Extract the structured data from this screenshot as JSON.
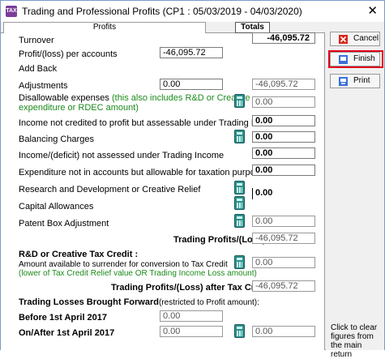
{
  "window": {
    "app_icon_text": "TAX",
    "title": "Trading and Professional Profits   (CP1 : 05/03/2019 - 04/03/2020)",
    "close_glyph": "✕"
  },
  "tabs": {
    "profits": "Profits",
    "totals": "Totals"
  },
  "rows": {
    "turnover": {
      "label": "Turnover",
      "total": "-46,095.72"
    },
    "profit_loss": {
      "label": "Profit/(loss) per accounts",
      "value": "-46,095.72"
    },
    "add_back": {
      "label": "Add Back"
    },
    "adjustments": {
      "label": "Adjustments",
      "value": "0.00",
      "total": "-46,095.72"
    },
    "disallowable": {
      "label": "Disallowable expenses",
      "note_line1": "(this also includes R&D or Creative",
      "note_line2": "expenditure or RDEC amount)",
      "total": "0.00"
    },
    "income_not_credited": {
      "label": "Income not credited to profit but assessable under Trading Income",
      "total": "0.00"
    },
    "balancing_charges": {
      "label": "Balancing Charges",
      "total": "0.00"
    },
    "income_deficit": {
      "label": "Income/(deficit) not assessed under Trading Income",
      "total": "0.00"
    },
    "expenditure_not_in_accounts": {
      "label": "Expenditure not in accounts but allowable for taxation purposes",
      "total": "0.00"
    },
    "research_creative": {
      "label": "Research and Development or Creative Relief",
      "total": "0.00"
    },
    "capital_allowances": {
      "label": "Capital Allowances"
    },
    "patent_box": {
      "label": "Patent Box Adjustment",
      "total": "0.00"
    },
    "trading_profits": {
      "label": "Trading Profits/(Loss)",
      "total": "-46,095.72"
    },
    "rd_credit": {
      "heading": "R&D or Creative Tax Credit :",
      "line1": "Amount available to surrender for conversion to Tax Credit",
      "line2": "(lower of Tax Credit Relief value OR Trading Income Loss amount)",
      "total": "0.00"
    },
    "after_tax_credits": {
      "label": "Trading Profits/(Loss) after Tax Credits",
      "total": "-46,095.72"
    },
    "losses_bf": {
      "heading": "Trading Losses Brought Forward",
      "suffix": "(restricted to Profit amount):"
    },
    "before_2017": {
      "label": "Before 1st April 2017",
      "value": "0.00"
    },
    "after_2017": {
      "label": "On/After 1st April 2017",
      "value": "0.00",
      "total": "0.00"
    }
  },
  "sidebar": {
    "cancel": "Cancel",
    "finish": "Finish",
    "print": "Print",
    "note": "Click to clear figures from the main return"
  },
  "colors": {
    "cancel_icon": "#d9261c",
    "finish_icon": "#3a6fd8",
    "print_icon": "#3a6fd8",
    "highlight": "#e1001b",
    "green_note": "#1b8a1b"
  }
}
